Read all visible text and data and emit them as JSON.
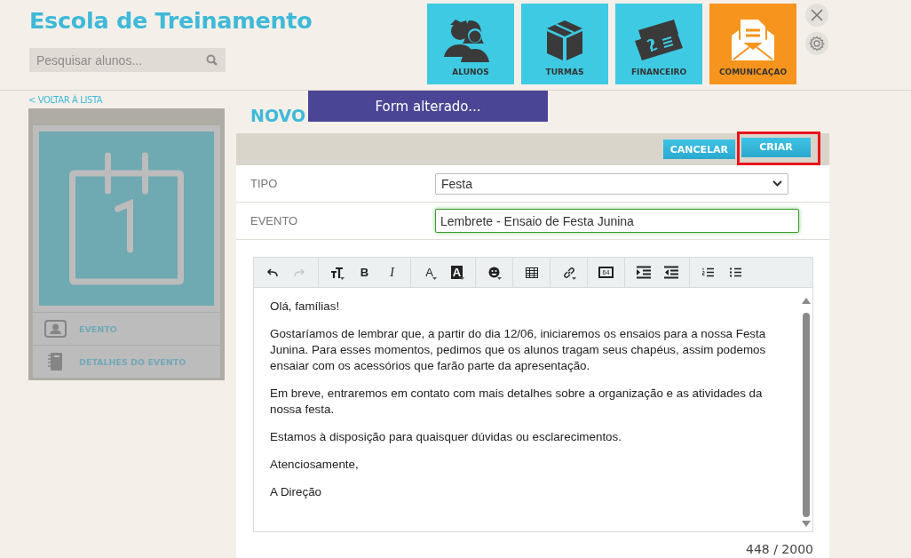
{
  "header": {
    "title": "Escola de Treinamento",
    "search": {
      "placeholder": "Pesquisar alunos..."
    }
  },
  "nav": [
    {
      "label": "ALUNOS",
      "kind": "people",
      "selected": false
    },
    {
      "label": "TURMAS",
      "kind": "box",
      "selected": false
    },
    {
      "label": "FINANCEIRO",
      "kind": "money",
      "selected": false
    },
    {
      "label": "COMUNICAÇAO",
      "kind": "mail",
      "selected": true
    }
  ],
  "back_link": "< VOLTAR À LISTA",
  "sidebar": {
    "items": [
      {
        "label": "EVENTO",
        "kind": "contact"
      },
      {
        "label": "DETALHES DO EVENTO",
        "kind": "notebook"
      }
    ]
  },
  "page_title": "NOVO",
  "toast": "Form alterado...",
  "actions": [
    {
      "label": "CANCELAR",
      "highlighted": false
    },
    {
      "label": "CRIAR",
      "highlighted": true
    }
  ],
  "form": [
    {
      "label": "TIPO",
      "kind": "select",
      "value": "Festa",
      "focused": false
    },
    {
      "label": "EVENTO",
      "kind": "input",
      "value": "Lembrete - Ensaio de Festa Junina",
      "focused": true
    }
  ],
  "editor": {
    "toolbar": [
      [
        {
          "kind": "undo",
          "disabled": false
        },
        {
          "kind": "redo",
          "disabled": true
        }
      ],
      [
        {
          "kind": "font-size",
          "dropdown": true
        },
        {
          "kind": "bold",
          "label": "B"
        },
        {
          "kind": "italic",
          "label": "I"
        }
      ],
      [
        {
          "kind": "color",
          "label": "A",
          "dropdown": true
        },
        {
          "kind": "highlight",
          "label": "A",
          "dropdown": true
        }
      ],
      [
        {
          "kind": "emoji",
          "dropdown": true
        }
      ],
      [
        {
          "kind": "table"
        }
      ],
      [
        {
          "kind": "link",
          "dropdown": true
        }
      ],
      [
        {
          "kind": "image64",
          "label": "64"
        }
      ],
      [
        {
          "kind": "indent"
        },
        {
          "kind": "outdent"
        }
      ],
      [
        {
          "kind": "ordered-list"
        },
        {
          "kind": "bullet-list"
        }
      ]
    ],
    "paragraphs": [
      "Olá, famílias!",
      "Gostaríamos de lembrar que, a partir do dia 12/06, iniciaremos os ensaios para a nossa Festa Junina. Para esses momentos, pedimos que os alunos tragam seus chapéus, assim podemos ensaiar com os acessórios que farão parte da apresentação.",
      "Em breve, entraremos em contato com mais detalhes sobre a organização e as atividades da nossa festa.",
      "Estamos à disposição para quaisquer dúvidas ou esclarecimentos.",
      "Atenciosamente,",
      "A Direção"
    ],
    "counter": "448 / 2000"
  }
}
